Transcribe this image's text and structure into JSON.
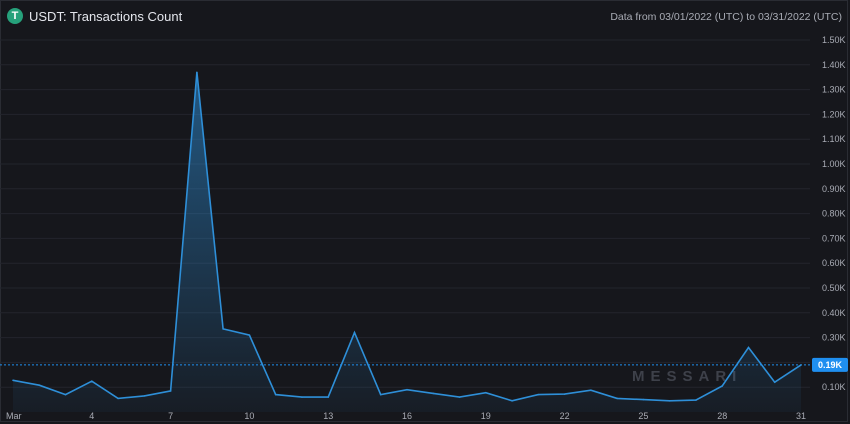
{
  "header": {
    "logo_letter": "T",
    "title": "USDT: Transactions Count",
    "date_range": "Data from 03/01/2022 (UTC) to 03/31/2022 (UTC)"
  },
  "watermark": "MESSARI",
  "current_value_label": "0.19K",
  "colors": {
    "line": "#2e8fd8",
    "badge": "#1f8ff0",
    "logo": "#26a17b",
    "background": "#16171c"
  },
  "chart_data": {
    "type": "area",
    "title": "USDT: Transactions Count",
    "x": [
      1,
      2,
      3,
      4,
      5,
      6,
      7,
      8,
      9,
      10,
      11,
      12,
      13,
      14,
      15,
      16,
      17,
      18,
      19,
      20,
      21,
      22,
      23,
      24,
      25,
      26,
      27,
      28,
      29,
      30,
      31
    ],
    "values": [
      128,
      108,
      70,
      124,
      55,
      65,
      85,
      1370,
      335,
      310,
      70,
      60,
      60,
      320,
      70,
      90,
      75,
      60,
      78,
      45,
      70,
      72,
      88,
      55,
      50,
      45,
      48,
      105,
      260,
      120,
      190
    ],
    "xticks": [
      {
        "value": 1,
        "label": "Mar"
      },
      {
        "value": 4,
        "label": "4"
      },
      {
        "value": 7,
        "label": "7"
      },
      {
        "value": 10,
        "label": "10"
      },
      {
        "value": 13,
        "label": "13"
      },
      {
        "value": 16,
        "label": "16"
      },
      {
        "value": 19,
        "label": "19"
      },
      {
        "value": 22,
        "label": "22"
      },
      {
        "value": 25,
        "label": "25"
      },
      {
        "value": 28,
        "label": "28"
      },
      {
        "value": 31,
        "label": "31"
      }
    ],
    "yticks": [
      {
        "value": 100,
        "label": "0.10K"
      },
      {
        "value": 200,
        "label": "0.20K"
      },
      {
        "value": 300,
        "label": "0.30K"
      },
      {
        "value": 400,
        "label": "0.40K"
      },
      {
        "value": 500,
        "label": "0.50K"
      },
      {
        "value": 600,
        "label": "0.60K"
      },
      {
        "value": 700,
        "label": "0.70K"
      },
      {
        "value": 800,
        "label": "0.80K"
      },
      {
        "value": 900,
        "label": "0.90K"
      },
      {
        "value": 1000,
        "label": "1.00K"
      },
      {
        "value": 1100,
        "label": "1.10K"
      },
      {
        "value": 1200,
        "label": "1.20K"
      },
      {
        "value": 1300,
        "label": "1.30K"
      },
      {
        "value": 1400,
        "label": "1.40K"
      },
      {
        "value": 1500,
        "label": "1.50K"
      }
    ],
    "current_value": 190,
    "xlim": [
      1,
      31
    ],
    "ylim": [
      0,
      1500
    ],
    "grid": true
  }
}
